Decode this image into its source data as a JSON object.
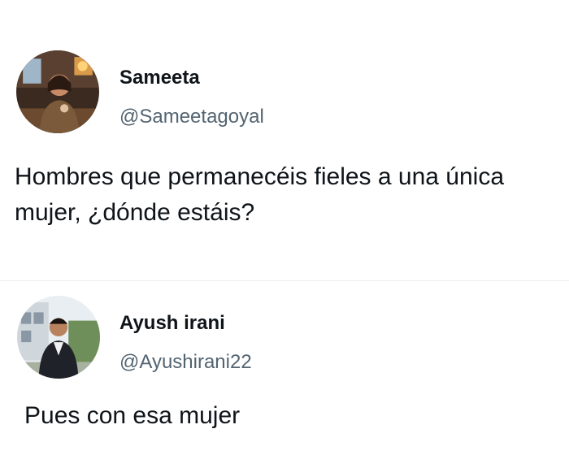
{
  "tweets": [
    {
      "display_name": "Sameeta",
      "handle": "@Sameetagoyal",
      "text": "Hombres que permanecéis fieles a una única mujer, ¿dónde estáis?",
      "avatar_icon": "user-avatar-photo"
    },
    {
      "display_name": "Ayush irani",
      "handle": "@Ayushirani22",
      "text": "Pues con esa mujer",
      "avatar_icon": "user-avatar-photo"
    }
  ],
  "colors": {
    "text": "#0f1419",
    "handle": "#536471",
    "background": "#ffffff"
  }
}
